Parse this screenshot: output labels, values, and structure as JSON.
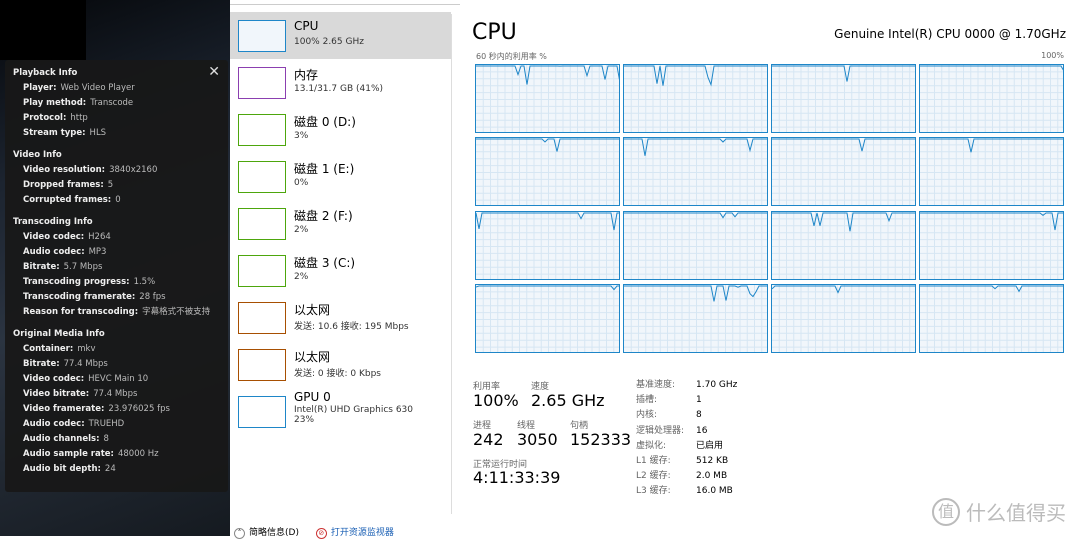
{
  "playback_panel": {
    "sections": [
      {
        "title": "Playback Info",
        "rows": [
          [
            "Player:",
            "Web Video Player"
          ],
          [
            "Play method:",
            "Transcode"
          ],
          [
            "Protocol:",
            "http"
          ],
          [
            "Stream type:",
            "HLS"
          ]
        ]
      },
      {
        "title": "Video Info",
        "rows": [
          [
            "Video resolution:",
            "3840x2160"
          ],
          [
            "Dropped frames:",
            "5"
          ],
          [
            "Corrupted frames:",
            "0"
          ]
        ]
      },
      {
        "title": "Transcoding Info",
        "rows": [
          [
            "Video codec:",
            "H264"
          ],
          [
            "Audio codec:",
            "MP3"
          ],
          [
            "Bitrate:",
            "5.7 Mbps"
          ],
          [
            "Transcoding progress:",
            "1.5%"
          ],
          [
            "Transcoding framerate:",
            "28 fps"
          ],
          [
            "Reason for transcoding:",
            "字幕格式不被支持"
          ]
        ]
      },
      {
        "title": "Original Media Info",
        "rows": [
          [
            "Container:",
            "mkv"
          ],
          [
            "Bitrate:",
            "77.4 Mbps"
          ],
          [
            "Video codec:",
            "HEVC Main 10"
          ],
          [
            "Video bitrate:",
            "77.4 Mbps"
          ],
          [
            "Video framerate:",
            "23.976025 fps"
          ],
          [
            "Audio codec:",
            "TRUEHD"
          ],
          [
            "Audio channels:",
            "8"
          ],
          [
            "Audio sample rate:",
            "48000 Hz"
          ],
          [
            "Audio bit depth:",
            "24"
          ]
        ]
      }
    ],
    "close_icon": "close-icon"
  },
  "sidebar": {
    "items": [
      {
        "name": "CPU",
        "sub": "100% 2.65 GHz",
        "color": "#1e86c8",
        "selected": true
      },
      {
        "name": "内存",
        "sub": "13.1/31.7 GB (41%)",
        "color": "#8b3fb0"
      },
      {
        "name": "磁盘 0 (D:)",
        "sub": "3%",
        "color": "#4da60c"
      },
      {
        "name": "磁盘 1 (E:)",
        "sub": "0%",
        "color": "#4da60c"
      },
      {
        "name": "磁盘 2 (F:)",
        "sub": "2%",
        "color": "#4da60c"
      },
      {
        "name": "磁盘 3 (C:)",
        "sub": "2%",
        "color": "#4da60c"
      },
      {
        "name": "以太网",
        "sub": "发送: 10.6 接收: 195 Mbps",
        "color": "#a74f01"
      },
      {
        "name": "以太网",
        "sub": "发送: 0 接收: 0 Kbps",
        "color": "#a74f01"
      },
      {
        "name": "GPU 0",
        "sub": "Intel(R) UHD Graphics 630",
        "sub2": "23%",
        "color": "#1e86c8"
      }
    ]
  },
  "main": {
    "title": "CPU",
    "model": "Genuine Intel(R) CPU 0000 @ 1.70GHz",
    "graph_left_label": "60 秒内的利用率 %",
    "graph_right_label": "100%",
    "utilization_label": "利用率",
    "utilization": "100%",
    "speed_label": "速度",
    "speed": "2.65 GHz",
    "processes_label": "进程",
    "processes": "242",
    "threads_label": "线程",
    "threads": "3050",
    "handles_label": "句柄",
    "handles": "152333",
    "uptime_label": "正常运行时间",
    "uptime": "4:11:33:39",
    "specs": [
      [
        "基准速度:",
        "1.70 GHz"
      ],
      [
        "插槽:",
        "1"
      ],
      [
        "内核:",
        "8"
      ],
      [
        "逻辑处理器:",
        "16"
      ],
      [
        "虚拟化:",
        "已启用"
      ],
      [
        "L1 缓存:",
        "512 KB"
      ],
      [
        "L2 缓存:",
        "2.0 MB"
      ],
      [
        "L3 缓存:",
        "16.0 MB"
      ]
    ]
  },
  "footer": {
    "fewer_details": "简略信息(D)",
    "open_monitor": "打开资源监视器"
  },
  "watermark": {
    "logo": "值",
    "text": "什么值得买"
  }
}
